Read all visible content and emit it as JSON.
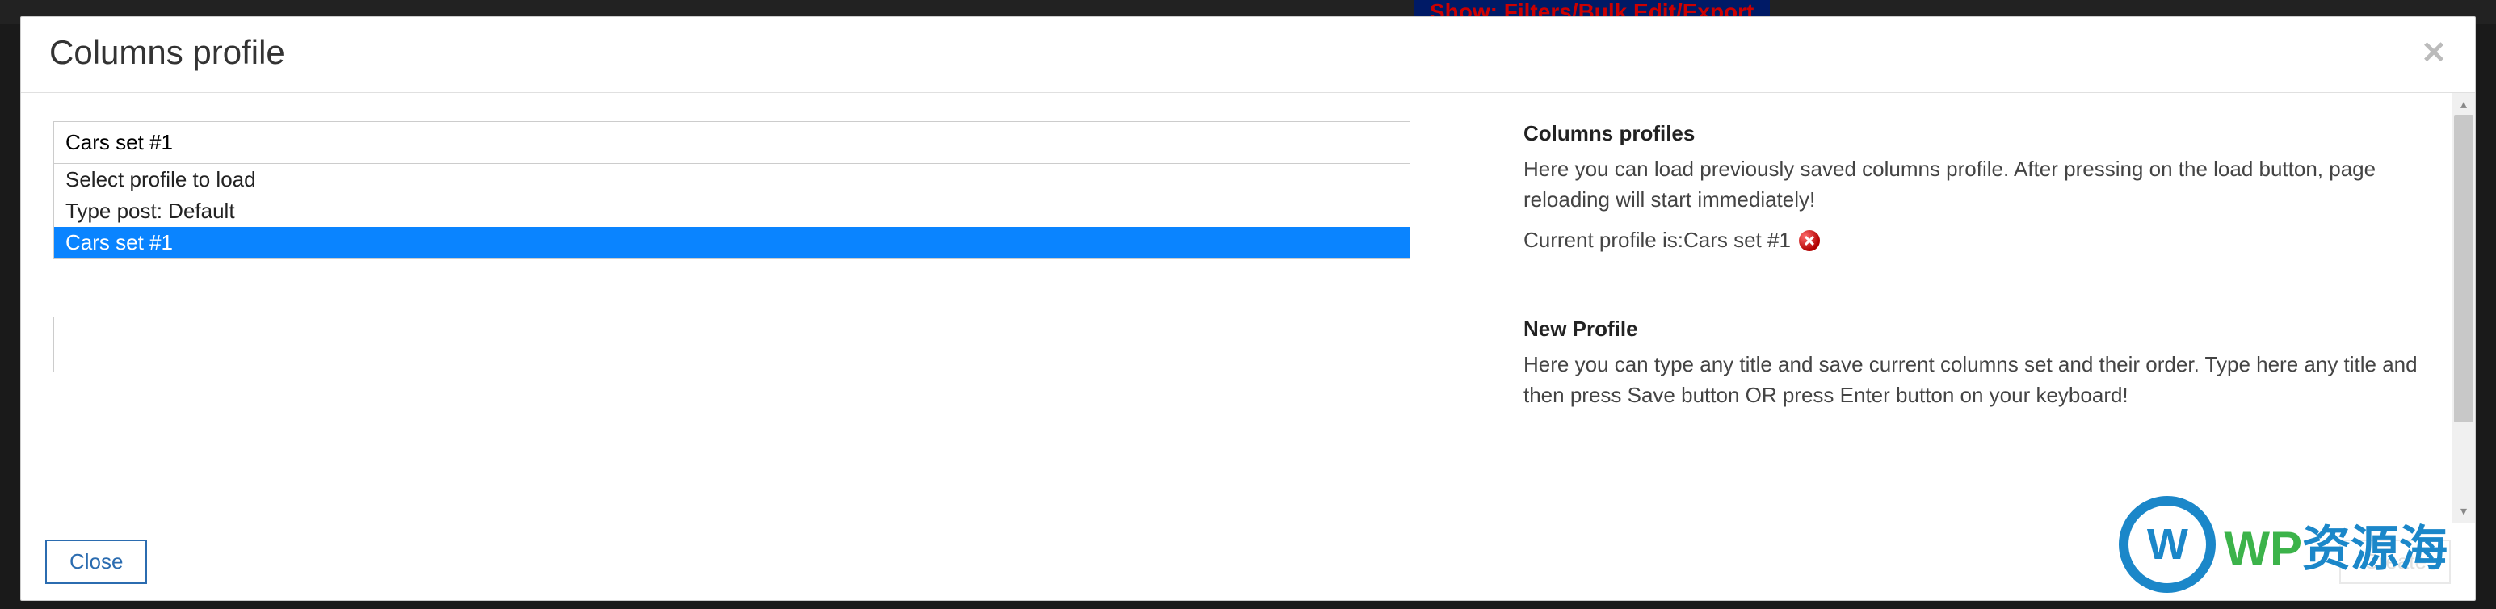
{
  "background": {
    "show_banner": "Show: Filters/Bulk Edit/Export"
  },
  "modal": {
    "title": "Columns profile",
    "close_btn": "Close",
    "create_btn": "Create"
  },
  "profiles_section": {
    "input_value": "Cars set #1",
    "dropdown": {
      "placeholder": "Select profile to load",
      "options": [
        "Type post: Default",
        "Cars set #1"
      ],
      "selected_index": 1
    },
    "heading": "Columns profiles",
    "desc": "Here you can load previously saved columns profile. After pressing on the load button, page reloading will start immediately!",
    "current_label": "Current profile is: ",
    "current_value": "Cars set #1"
  },
  "new_profile_section": {
    "heading": "New Profile",
    "desc": "Here you can type any title and save current columns set and their order. Type here any title and then press Save button OR press Enter button on your keyboard!",
    "input_value": ""
  },
  "watermark": {
    "badge": "W",
    "text_parts": [
      "WP",
      "资源海"
    ]
  }
}
